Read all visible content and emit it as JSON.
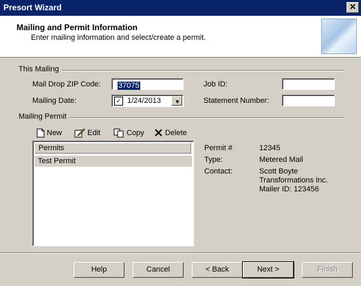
{
  "window": {
    "title": "Presort Wizard",
    "close_glyph": "✕"
  },
  "header": {
    "title": "Mailing and Permit Information",
    "subtitle": "Enter mailing information and select/create a permit."
  },
  "this_mailing": {
    "section_label": "This Mailing",
    "zip_label": "Mail Drop ZIP Code:",
    "zip_value": "37075",
    "date_label": "Mailing Date:",
    "date_value": "1/24/2013",
    "date_checked": true,
    "job_label": "Job ID:",
    "job_value": "",
    "statement_label": "Statement Number:",
    "statement_value": ""
  },
  "mailing_permit": {
    "section_label": "Mailing Permit",
    "toolbar": {
      "new": "New",
      "edit": "Edit",
      "copy": "Copy",
      "delete": "Delete"
    },
    "list_header": "Permits",
    "permits": [
      "Test Permit"
    ],
    "details": {
      "permit_label": "Permit #",
      "permit_value": "12345",
      "type_label": "Type:",
      "type_value": "Metered Mail",
      "contact_label": "Contact:",
      "contact_lines": [
        "Scott Boyte",
        "Transformations Inc.",
        "Mailer ID: 123456"
      ]
    }
  },
  "footer": {
    "help": "Help",
    "cancel": "Cancel",
    "back": "< Back",
    "next": "Next >",
    "finish": "Finish"
  }
}
